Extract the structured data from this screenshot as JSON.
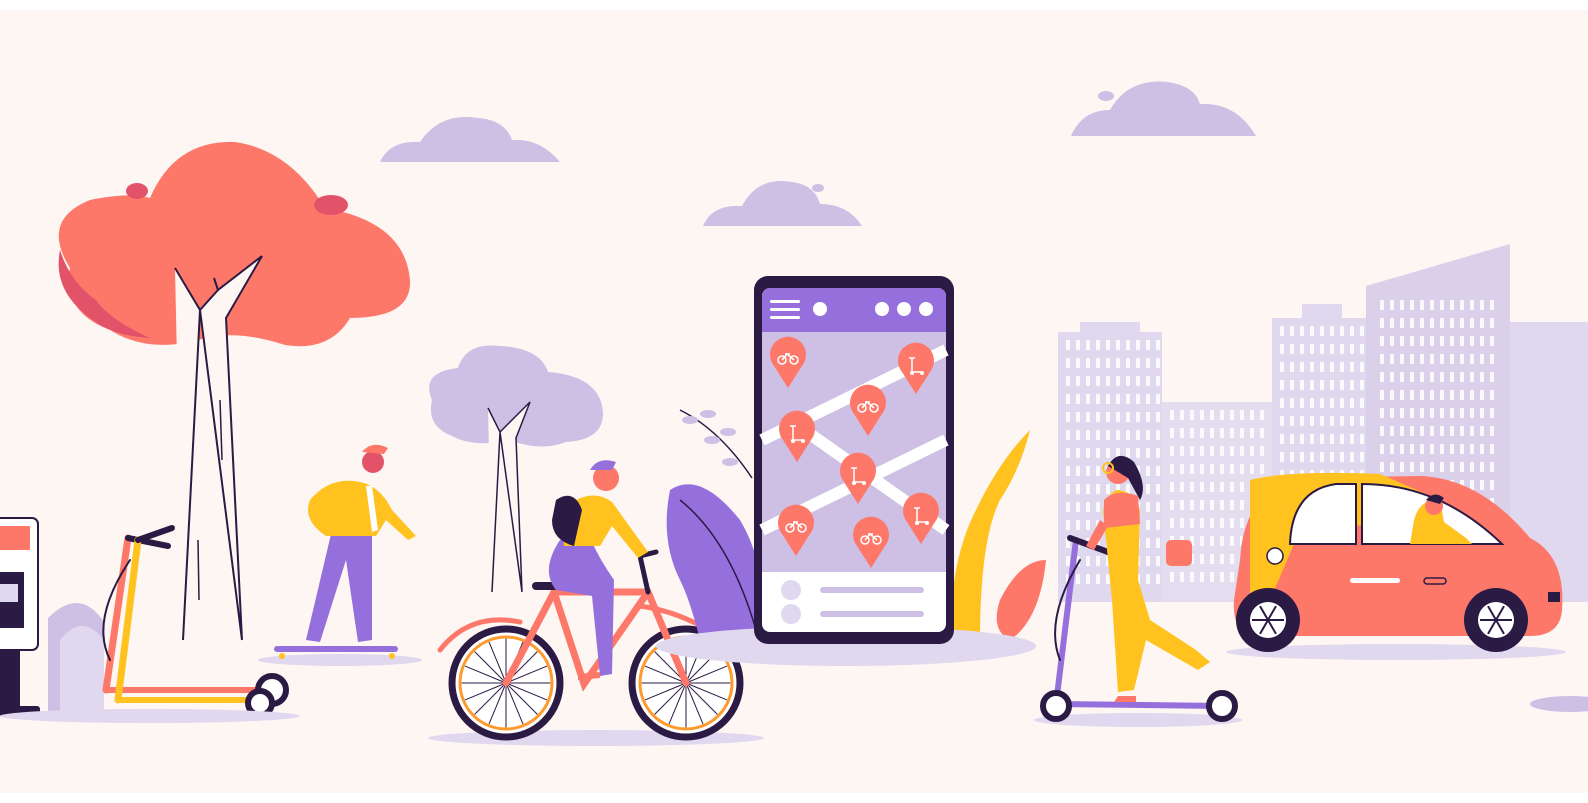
{
  "colors": {
    "background": "#fdf6f3",
    "border": "#ffffff",
    "coral": "#fe786a",
    "coral_dark": "#e2536a",
    "lavender": "#cdc0e4",
    "lavender_light": "#e0d8ee",
    "purple": "#9570dd",
    "purple_dark": "#6f4fc4",
    "navy": "#2b1a44",
    "yellow": "#ffc21f",
    "orange": "#ff9b2e",
    "white": "#ffffff"
  },
  "phone": {
    "menu_icon": "hamburger-menu-icon",
    "header_dots": 4,
    "list_rows": 2,
    "pins": [
      {
        "icon": "bicycle-icon"
      },
      {
        "icon": "scooter-icon"
      },
      {
        "icon": "bicycle-icon"
      },
      {
        "icon": "scooter-icon"
      },
      {
        "icon": "scooter-icon"
      },
      {
        "icon": "bicycle-icon"
      },
      {
        "icon": "scooter-icon"
      },
      {
        "icon": "bicycle-icon"
      }
    ]
  },
  "scene_elements": [
    "scooter-docking-station",
    "parked-electric-scooters",
    "coral-tree",
    "skateboarder",
    "lavender-tree",
    "cyclist",
    "smartphone-rental-app",
    "decorative-plants",
    "city-buildings",
    "woman-on-electric-scooter",
    "red-smart-car-with-driver"
  ]
}
